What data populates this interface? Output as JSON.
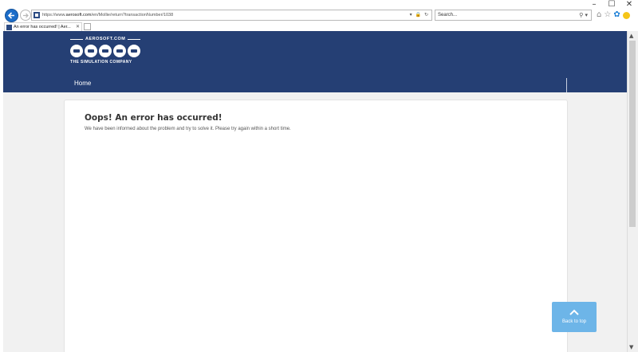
{
  "window": {
    "minimize": "–",
    "maximize": "☐",
    "close": "✕"
  },
  "browser": {
    "url_prefix": "https://www.",
    "url_domain": "aerosoft.com",
    "url_path": "/en/Mollie/return?transactionNumber/1038",
    "addr_icons": "▾ 🔒 ↻",
    "search_placeholder": "Search...",
    "search_icon": "⚲ ▾",
    "home_icon": "⌂",
    "favorites_icon": "☆",
    "settings_icon": "✿"
  },
  "tab": {
    "title": "An error has occurred! | Aer...",
    "close": "✕"
  },
  "header": {
    "logo_top": "AEROSOFT.COM",
    "logo_bottom": "THE SIMULATION COMPANY",
    "nav_home": "Home"
  },
  "error": {
    "title": "Oops! An error has occurred!",
    "message": "We have been informed about the problem and try to solve it. Please try again within a short time."
  },
  "back_to_top": {
    "label": "Back to top"
  },
  "scrollbar": {
    "up": "▲",
    "down": "▼"
  },
  "colors": {
    "header_bg": "#253f74",
    "back_to_top_bg": "#6db5e8",
    "page_bg": "#f1f1f1"
  }
}
